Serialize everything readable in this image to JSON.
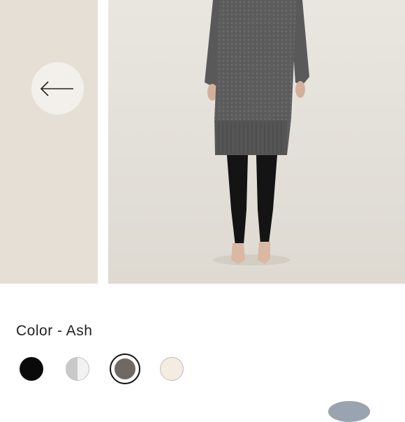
{
  "product": {
    "color_label": "Color - Ash"
  },
  "gallery": {
    "prev_icon": "arrow-left-icon"
  },
  "swatches": [
    {
      "name": "black",
      "color": "#0a0a0a",
      "selected": false
    },
    {
      "name": "gray-split",
      "color_left": "#c9c9c9",
      "color_right": "#f2f2f2",
      "selected": false
    },
    {
      "name": "ash",
      "color": "#6e6965",
      "selected": true
    },
    {
      "name": "cream",
      "color": "#f4ece0",
      "selected": false
    }
  ]
}
